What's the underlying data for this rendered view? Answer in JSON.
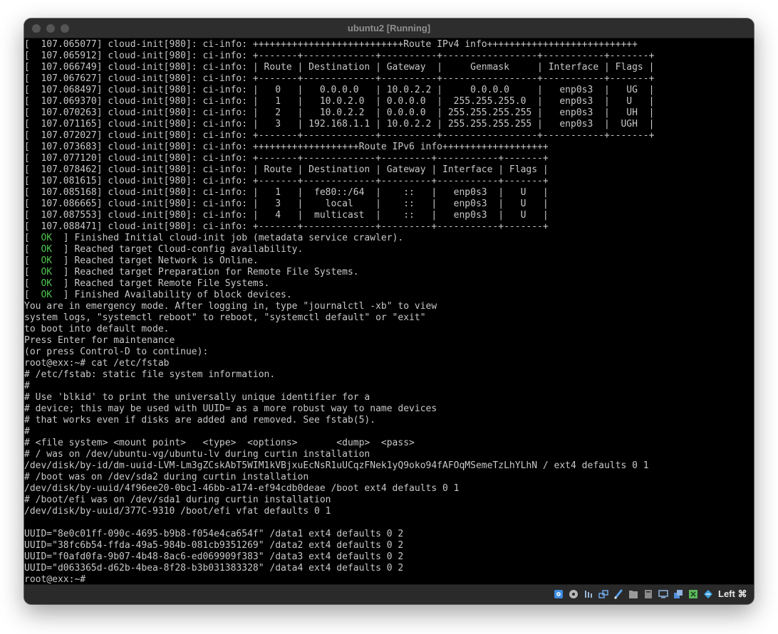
{
  "window": {
    "title": "ubuntu2 [Running]"
  },
  "console": {
    "lines": [
      {
        "text": "[  107.065077] cloud-init[980]: ci-info: +++++++++++++++++++++++++++Route IPv4 info+++++++++++++++++++++++++++"
      },
      {
        "text": "[  107.065912] cloud-init[980]: ci-info: +-------+-------------+----------+-----------------+-----------+-------+"
      },
      {
        "text": "[  107.066749] cloud-init[980]: ci-info: | Route | Destination | Gateway  |     Genmask     | Interface | Flags |"
      },
      {
        "text": "[  107.067627] cloud-init[980]: ci-info: +-------+-------------+----------+-----------------+-----------+-------+"
      },
      {
        "text": "[  107.068497] cloud-init[980]: ci-info: |   0   |   0.0.0.0   | 10.0.2.2 |     0.0.0.0     |   enp0s3  |   UG  |"
      },
      {
        "text": "[  107.069370] cloud-init[980]: ci-info: |   1   |   10.0.2.0  | 0.0.0.0  |  255.255.255.0  |   enp0s3  |   U   |"
      },
      {
        "text": "[  107.070263] cloud-init[980]: ci-info: |   2   |   10.0.2.2  | 0.0.0.0  | 255.255.255.255 |   enp0s3  |   UH  |"
      },
      {
        "text": "[  107.071165] cloud-init[980]: ci-info: |   3   | 192.168.1.1 | 10.0.2.2 | 255.255.255.255 |   enp0s3  |  UGH  |"
      },
      {
        "text": "[  107.072027] cloud-init[980]: ci-info: +-------+-------------+----------+-----------------+-----------+-------+"
      },
      {
        "text": "[  107.073683] cloud-init[980]: ci-info: +++++++++++++++++++Route IPv6 info+++++++++++++++++++"
      },
      {
        "text": "[  107.077120] cloud-init[980]: ci-info: +-------+-------------+---------+-----------+-------+"
      },
      {
        "text": "[  107.078462] cloud-init[980]: ci-info: | Route | Destination | Gateway | Interface | Flags |"
      },
      {
        "text": "[  107.081615] cloud-init[980]: ci-info: +-------+-------------+---------+-----------+-------+"
      },
      {
        "text": "[  107.085168] cloud-init[980]: ci-info: |   1   |  fe80::/64  |    ::   |   enp0s3  |   U   |"
      },
      {
        "text": "[  107.086665] cloud-init[980]: ci-info: |   3   |    local    |    ::   |   enp0s3  |   U   |"
      },
      {
        "text": "[  107.087553] cloud-init[980]: ci-info: |   4   |  multicast  |    ::   |   enp0s3  |   U   |"
      },
      {
        "text": "[  107.088471] cloud-init[980]: ci-info: +-------+-------------+---------+-----------+-------+"
      },
      {
        "pre": "[  ",
        "ok": "OK",
        "post": "  ] Finished Initial cloud-init job (metadata service crawler)."
      },
      {
        "pre": "[  ",
        "ok": "OK",
        "post": "  ] Reached target Cloud-config availability."
      },
      {
        "pre": "[  ",
        "ok": "OK",
        "post": "  ] Reached target Network is Online."
      },
      {
        "pre": "[  ",
        "ok": "OK",
        "post": "  ] Reached target Preparation for Remote File Systems."
      },
      {
        "pre": "[  ",
        "ok": "OK",
        "post": "  ] Reached target Remote File Systems."
      },
      {
        "pre": "[  ",
        "ok": "OK",
        "post": "  ] Finished Availability of block devices."
      },
      {
        "text": "You are in emergency mode. After logging in, type \"journalctl -xb\" to view"
      },
      {
        "text": "system logs, \"systemctl reboot\" to reboot, \"systemctl default\" or \"exit\""
      },
      {
        "text": "to boot into default mode."
      },
      {
        "text": "Press Enter for maintenance"
      },
      {
        "text": "(or press Control-D to continue):"
      },
      {
        "text": "root@exx:~# cat /etc/fstab"
      },
      {
        "text": "# /etc/fstab: static file system information."
      },
      {
        "text": "#"
      },
      {
        "text": "# Use 'blkid' to print the universally unique identifier for a"
      },
      {
        "text": "# device; this may be used with UUID= as a more robust way to name devices"
      },
      {
        "text": "# that works even if disks are added and removed. See fstab(5)."
      },
      {
        "text": "#"
      },
      {
        "text": "# <file system> <mount point>   <type>  <options>       <dump>  <pass>"
      },
      {
        "text": "# / was on /dev/ubuntu-vg/ubuntu-lv during curtin installation"
      },
      {
        "text": "/dev/disk/by-id/dm-uuid-LVM-Lm3gZCskAbT5WIM1kVBjxuEcNsR1uUCqzFNek1yQ9oko94fAFOqMSemeTzLhYLhN / ext4 defaults 0 1"
      },
      {
        "text": "# /boot was on /dev/sda2 during curtin installation"
      },
      {
        "text": "/dev/disk/by-uuid/4f96ee20-0bc1-46bb-a174-ef94cdb0deae /boot ext4 defaults 0 1"
      },
      {
        "text": "# /boot/efi was on /dev/sda1 during curtin installation"
      },
      {
        "text": "/dev/disk/by-uuid/377C-9310 /boot/efi vfat defaults 0 1"
      },
      {
        "text": ""
      },
      {
        "text": "UUID=\"8e0c01ff-090c-4695-b9b8-f054e4ca654f\" /data1 ext4 defaults 0 2"
      },
      {
        "text": "UUID=\"38fc6b54-ffda-49a5-984b-081cb9351269\" /data2 ext4 defaults 0 2"
      },
      {
        "text": "UUID=\"f0afd0fa-9b07-4b48-8ac6-ed069909f383\" /data3 ext4 defaults 0 2"
      },
      {
        "text": "UUID=\"d063365d-d62b-4bea-8f28-b3b031383328\" /data4 ext4 defaults 0 2"
      },
      {
        "text": "root@exx:~#"
      }
    ]
  },
  "statusbar": {
    "host_key_label": "Left ⌘",
    "icons": [
      {
        "name": "hard-disk-icon",
        "color": "#3d8be0"
      },
      {
        "name": "optical-drive-icon",
        "color": "#b8b8b8"
      },
      {
        "name": "audio-icon",
        "color": "#9ab6d8"
      },
      {
        "name": "network-icon",
        "color": "#6fa7e6"
      },
      {
        "name": "usb-icon",
        "color": "#5aa0e8"
      },
      {
        "name": "shared-folders-icon",
        "color": "#9a9a9a"
      },
      {
        "name": "display-icon",
        "color": "#8fb3e0"
      },
      {
        "name": "video-capture-icon",
        "color": "#4f8fdc"
      },
      {
        "name": "recording-icon",
        "color": "#5cb85c"
      },
      {
        "name": "mouse-integration-icon",
        "color": "#3fa2e0"
      },
      {
        "name": "keyboard-capture-icon",
        "color": "#2f7fd8"
      }
    ]
  }
}
